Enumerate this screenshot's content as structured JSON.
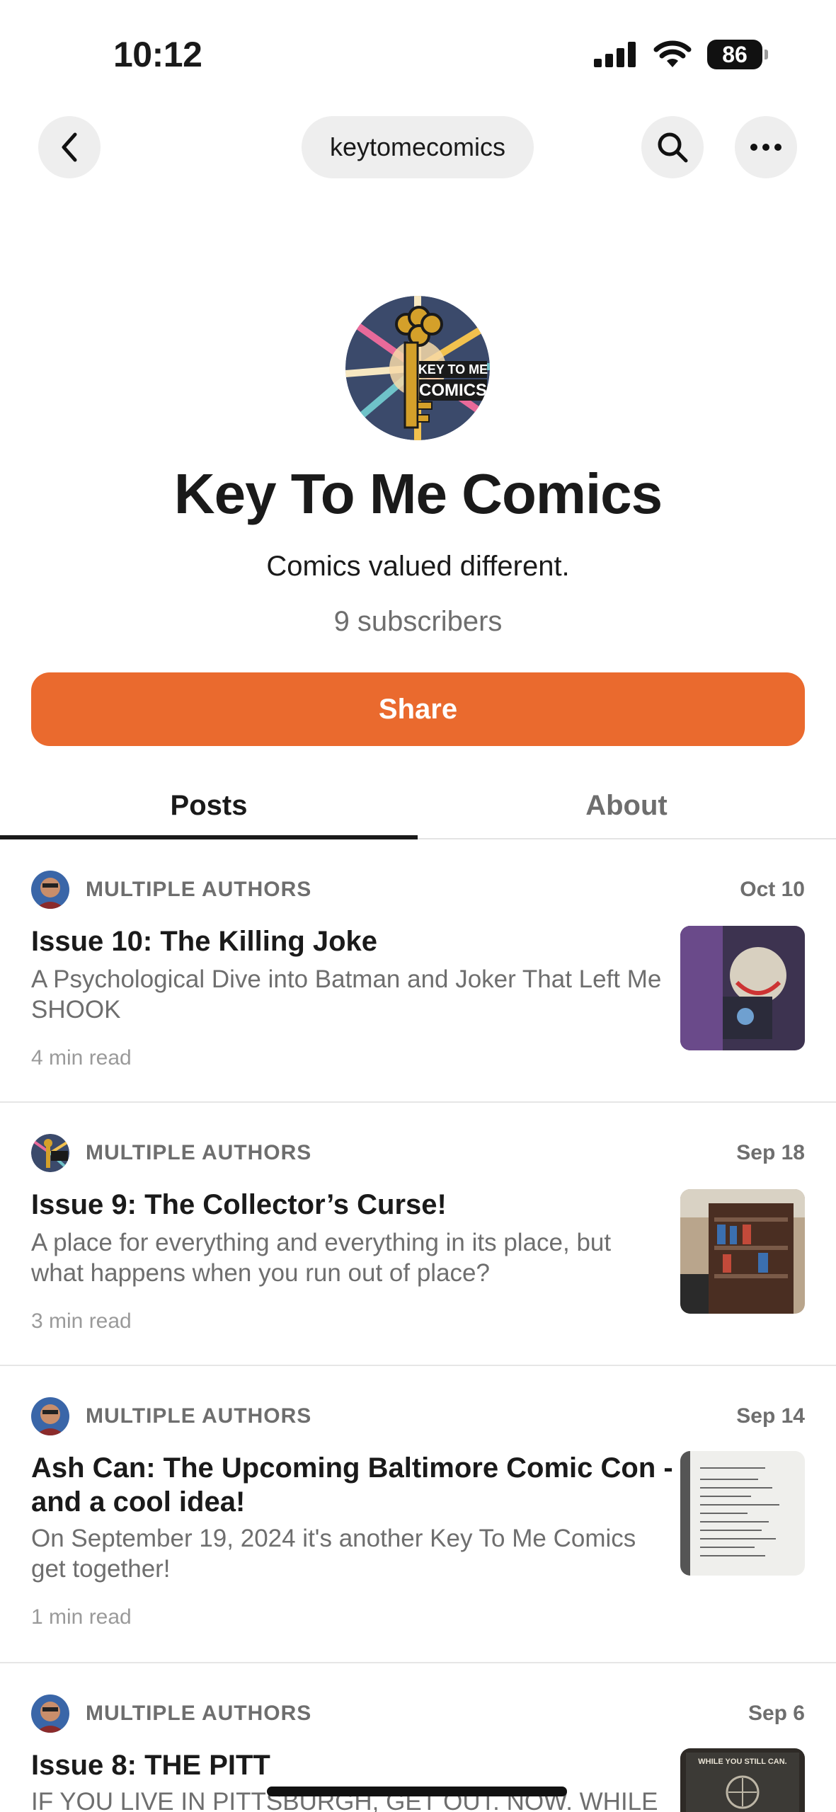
{
  "status_bar": {
    "time": "10:12",
    "battery": "86"
  },
  "nav": {
    "handle": "keytomecomics"
  },
  "publication": {
    "logo_text_line1": "KEY TO ME",
    "logo_text_line2": "COMICS",
    "title": "Key To Me Comics",
    "tagline": "Comics valued different.",
    "subscribers": "9 subscribers",
    "share_label": "Share"
  },
  "tabs": [
    {
      "label": "Posts",
      "active": true
    },
    {
      "label": "About",
      "active": false
    }
  ],
  "posts": [
    {
      "author": "MULTIPLE AUTHORS",
      "date": "Oct 10",
      "title": "Issue 10: The Killing Joke",
      "subtitle": "A Psychological Dive into Batman and Joker That Left Me SHOOK",
      "read_time": "4 min read"
    },
    {
      "author": "MULTIPLE AUTHORS",
      "date": "Sep 18",
      "title": "Issue 9: The Collector’s Curse!",
      "subtitle": "A place for everything and everything in its place, but what happens when you run out of place?",
      "read_time": "3 min read"
    },
    {
      "author": "MULTIPLE AUTHORS",
      "date": "Sep 14",
      "title": "Ash Can: The Upcoming Baltimore Comic Con - and a cool idea!",
      "subtitle": "On September 19, 2024 it's another Key To Me Comics get together!",
      "read_time": "1 min read"
    },
    {
      "author": "MULTIPLE AUTHORS",
      "date": "Sep 6",
      "title": "Issue 8: THE PITT",
      "subtitle": "IF YOU LIVE IN PITTSBURGH, GET OUT. NOW. WHILE",
      "thumb_text": "WHILE YOU STILL CAN."
    }
  ],
  "colors": {
    "accent": "#ea6a2e",
    "muted": "#6e6e6e",
    "pill_bg": "#eeeeee"
  }
}
